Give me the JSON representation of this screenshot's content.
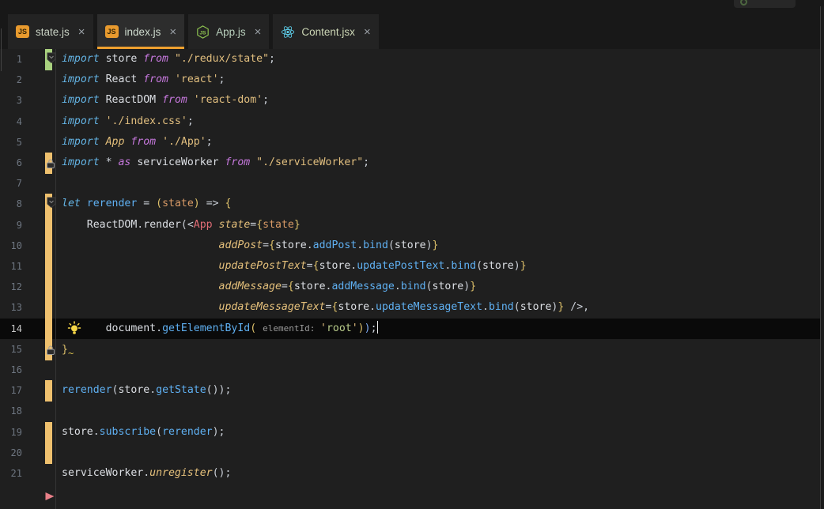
{
  "tabs": [
    {
      "label": "state.js",
      "icon": "js-square-icon",
      "icon_text": "JS",
      "icon_color": "#e89a2e",
      "label_color": "#c9d2c4",
      "active": false,
      "close": "×"
    },
    {
      "label": "index.js",
      "icon": "js-square-icon",
      "icon_text": "JS",
      "icon_color": "#e89a2e",
      "label_color": "#cfdccf",
      "active": true,
      "close": "×"
    },
    {
      "label": "App.js",
      "icon": "node-hexagon-icon",
      "icon_text": "JS",
      "icon_color": "#8ec350",
      "label_color": "#b9d0bd",
      "active": false,
      "close": "×"
    },
    {
      "label": "Content.jsx",
      "icon": "react-atom-icon",
      "icon_text": "",
      "icon_color": "#5fd3f0",
      "label_color": "#ccd6b5",
      "active": false,
      "close": "×"
    }
  ],
  "colors": {
    "accent_orange": "#efa02f",
    "git_added": "#a9d17f",
    "git_modified": "#eec06e",
    "error_triangle": "#e87f88",
    "lightbulb": "#f7d747"
  },
  "editor": {
    "current_line": 14,
    "inline_hint": "elementId:",
    "lines": [
      {
        "n": 1,
        "marker": "added",
        "icon": "shield-chevron-icon",
        "tokens": [
          [
            "kw",
            "import"
          ],
          [
            "pu",
            " "
          ],
          [
            "id",
            "store"
          ],
          [
            "mod",
            " from "
          ],
          [
            "str",
            "\"./redux/state\""
          ],
          [
            "pu",
            ";"
          ]
        ]
      },
      {
        "n": 2,
        "marker": null,
        "icon": null,
        "tokens": [
          [
            "kw",
            "import"
          ],
          [
            "pu",
            " "
          ],
          [
            "id",
            "React"
          ],
          [
            "mod",
            " from "
          ],
          [
            "str",
            "'react'"
          ],
          [
            "pu",
            ";"
          ]
        ]
      },
      {
        "n": 3,
        "marker": null,
        "icon": null,
        "tokens": [
          [
            "kw",
            "import"
          ],
          [
            "pu",
            " "
          ],
          [
            "id",
            "ReactDOM"
          ],
          [
            "mod",
            " from "
          ],
          [
            "str",
            "'react-dom'"
          ],
          [
            "pu",
            ";"
          ]
        ]
      },
      {
        "n": 4,
        "marker": null,
        "icon": null,
        "tokens": [
          [
            "kw",
            "import"
          ],
          [
            "pu",
            " "
          ],
          [
            "str",
            "'./index.css'"
          ],
          [
            "pu",
            ";"
          ]
        ]
      },
      {
        "n": 5,
        "marker": null,
        "icon": null,
        "tokens": [
          [
            "kw",
            "import"
          ],
          [
            "pu",
            " "
          ],
          [
            "attr",
            "App"
          ],
          [
            "mod",
            " from "
          ],
          [
            "str",
            "'./App'"
          ],
          [
            "pu",
            ";"
          ]
        ]
      },
      {
        "n": 6,
        "marker": "modified",
        "icon": "lock-icon",
        "tokens": [
          [
            "kw",
            "import"
          ],
          [
            "pu",
            " * "
          ],
          [
            "mod",
            "as"
          ],
          [
            "pu",
            " "
          ],
          [
            "id",
            "serviceWorker"
          ],
          [
            "mod",
            " from "
          ],
          [
            "str",
            "\"./serviceWorker\""
          ],
          [
            "pu",
            ";"
          ]
        ]
      },
      {
        "n": 7,
        "marker": null,
        "icon": null,
        "tokens": []
      },
      {
        "n": 8,
        "marker": "modified",
        "icon": "shield-chevron-icon",
        "tokens": [
          [
            "kw",
            "let"
          ],
          [
            "pu",
            " "
          ],
          [
            "fn",
            "rerender"
          ],
          [
            "pu",
            " = "
          ],
          [
            "br",
            "("
          ],
          [
            "par",
            "state"
          ],
          [
            "br",
            ")"
          ],
          [
            "pu",
            " => "
          ],
          [
            "br",
            "{"
          ]
        ]
      },
      {
        "n": 9,
        "marker": "modified",
        "icon": null,
        "tokens": [
          [
            "ws",
            "    "
          ],
          [
            "id",
            "ReactDOM"
          ],
          [
            "pu",
            "."
          ],
          [
            "id",
            "render"
          ],
          [
            "pu",
            "(<"
          ],
          [
            "comp",
            "App"
          ],
          [
            "pu",
            " "
          ],
          [
            "attr",
            "state"
          ],
          [
            "pu",
            "="
          ],
          [
            "br",
            "{"
          ],
          [
            "par",
            "state"
          ],
          [
            "br",
            "}"
          ]
        ]
      },
      {
        "n": 10,
        "marker": "modified",
        "icon": null,
        "tokens": [
          [
            "ws",
            "                         "
          ],
          [
            "attr",
            "addPost"
          ],
          [
            "pu",
            "="
          ],
          [
            "br",
            "{"
          ],
          [
            "id",
            "store"
          ],
          [
            "pu",
            "."
          ],
          [
            "fn",
            "addPost"
          ],
          [
            "pu",
            "."
          ],
          [
            "fn",
            "bind"
          ],
          [
            "pu",
            "("
          ],
          [
            "id",
            "store"
          ],
          [
            "pu",
            ")"
          ],
          [
            "br",
            "}"
          ]
        ]
      },
      {
        "n": 11,
        "marker": "modified",
        "icon": null,
        "tokens": [
          [
            "ws",
            "                         "
          ],
          [
            "attr",
            "updatePostText"
          ],
          [
            "pu",
            "="
          ],
          [
            "br",
            "{"
          ],
          [
            "id",
            "store"
          ],
          [
            "pu",
            "."
          ],
          [
            "fn",
            "updatePostText"
          ],
          [
            "pu",
            "."
          ],
          [
            "fn",
            "bind"
          ],
          [
            "pu",
            "("
          ],
          [
            "id",
            "store"
          ],
          [
            "pu",
            ")"
          ],
          [
            "br",
            "}"
          ]
        ]
      },
      {
        "n": 12,
        "marker": "modified",
        "icon": null,
        "tokens": [
          [
            "ws",
            "                         "
          ],
          [
            "attr",
            "addMessage"
          ],
          [
            "pu",
            "="
          ],
          [
            "br",
            "{"
          ],
          [
            "id",
            "store"
          ],
          [
            "pu",
            "."
          ],
          [
            "fn",
            "addMessage"
          ],
          [
            "pu",
            "."
          ],
          [
            "fn",
            "bind"
          ],
          [
            "pu",
            "("
          ],
          [
            "id",
            "store"
          ],
          [
            "pu",
            ")"
          ],
          [
            "br",
            "}"
          ]
        ]
      },
      {
        "n": 13,
        "marker": "modified",
        "icon": null,
        "tokens": [
          [
            "ws",
            "                         "
          ],
          [
            "attr",
            "updateMessageText"
          ],
          [
            "pu",
            "="
          ],
          [
            "br",
            "{"
          ],
          [
            "id",
            "store"
          ],
          [
            "pu",
            "."
          ],
          [
            "fn",
            "updateMessageText"
          ],
          [
            "pu",
            "."
          ],
          [
            "fn",
            "bind"
          ],
          [
            "pu",
            "("
          ],
          [
            "id",
            "store"
          ],
          [
            "pu",
            ")"
          ],
          [
            "br",
            "}"
          ],
          [
            "pu",
            " />,"
          ]
        ]
      },
      {
        "n": 14,
        "marker": "modified",
        "icon": "lightbulb-icon",
        "tokens": [
          [
            "ws",
            "       "
          ],
          [
            "id",
            "document"
          ],
          [
            "pu",
            "."
          ],
          [
            "fn",
            "getElementById"
          ],
          [
            "br",
            "("
          ],
          [
            "pu",
            " "
          ],
          [
            "hint",
            "elementId: "
          ],
          [
            "str",
            "'"
          ],
          [
            "strg",
            "root"
          ],
          [
            "str",
            "'"
          ],
          [
            "br",
            ")"
          ],
          [
            "pb",
            ")"
          ],
          [
            "pu",
            ";"
          ],
          [
            "cursor",
            ""
          ]
        ]
      },
      {
        "n": 15,
        "marker": "modified",
        "icon": "lock-icon",
        "tokens": [
          [
            "br",
            "}"
          ],
          [
            "sq",
            "~"
          ]
        ]
      },
      {
        "n": 16,
        "marker": null,
        "icon": null,
        "tokens": []
      },
      {
        "n": 17,
        "marker": "modified",
        "icon": null,
        "tokens": [
          [
            "fn",
            "rerender"
          ],
          [
            "pu",
            "("
          ],
          [
            "id",
            "store"
          ],
          [
            "pu",
            "."
          ],
          [
            "fn",
            "getState"
          ],
          [
            "pu",
            "());"
          ]
        ]
      },
      {
        "n": 18,
        "marker": null,
        "icon": null,
        "tokens": []
      },
      {
        "n": 19,
        "marker": "modified",
        "icon": null,
        "tokens": [
          [
            "id",
            "store"
          ],
          [
            "pu",
            "."
          ],
          [
            "fn",
            "subscribe"
          ],
          [
            "pu",
            "("
          ],
          [
            "fn",
            "rerender"
          ],
          [
            "pu",
            ");"
          ]
        ]
      },
      {
        "n": 20,
        "marker": "modified",
        "icon": null,
        "tokens": []
      },
      {
        "n": 21,
        "marker": null,
        "icon": null,
        "tokens": [
          [
            "id",
            "serviceWorker"
          ],
          [
            "pu",
            "."
          ],
          [
            "attr",
            "unregister"
          ],
          [
            "pu",
            "();"
          ]
        ]
      }
    ],
    "gutter_extra": {
      "row": 22,
      "icon": "triangle-right-icon"
    }
  }
}
